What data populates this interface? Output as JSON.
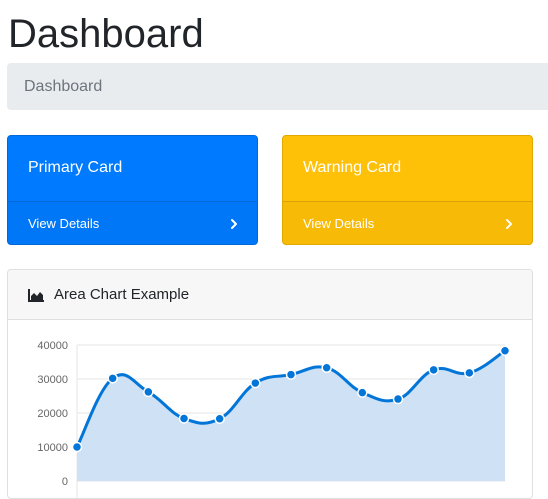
{
  "page_title": "Dashboard",
  "breadcrumb": {
    "active": "Dashboard"
  },
  "cards": [
    {
      "title": "Primary Card",
      "link": "View Details",
      "color": "#007bff"
    },
    {
      "title": "Warning Card",
      "link": "View Details",
      "color": "#ffc107"
    }
  ],
  "chart": {
    "header": "Area Chart Example",
    "icon": "area-chart-icon",
    "line_color": "#0275d8",
    "fill_color": "#cfe1f5"
  },
  "chart_data": {
    "type": "area",
    "x": [
      1,
      2,
      3,
      4,
      5,
      6,
      7,
      8,
      9,
      10,
      11,
      12,
      13
    ],
    "values": [
      10000,
      30200,
      26200,
      18400,
      18300,
      28800,
      31300,
      33300,
      26000,
      24100,
      32700,
      31800,
      38300
    ],
    "yticks": [
      0,
      10000,
      20000,
      30000,
      40000
    ],
    "ylim": [
      0,
      40000
    ],
    "grid": true,
    "legend": "none"
  }
}
